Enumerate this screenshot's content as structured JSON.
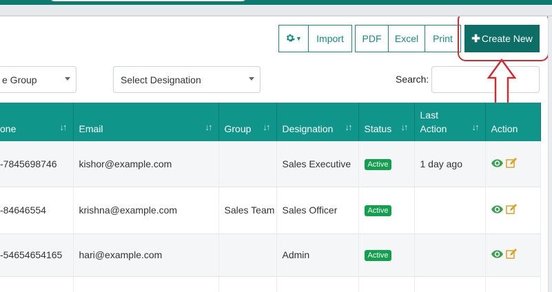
{
  "toolbar": {
    "import_label": "Import",
    "pdf_label": "PDF",
    "excel_label": "Excel",
    "print_label": "Print",
    "create_label": "Create New",
    "gear_icon": "gear-icon",
    "plus_icon": "plus-icon"
  },
  "filters": {
    "group_select": "e Group",
    "designation_select": "Select Designation",
    "search_label": "Search:",
    "search_value": ""
  },
  "table": {
    "columns": [
      "one",
      "Email",
      "Group",
      "Designation",
      "Status",
      "Last Action",
      "Action"
    ],
    "rows": [
      {
        "phone": "-7845698746",
        "email": "kishor@example.com",
        "group": "",
        "designation": "Sales Executive",
        "status": "Active",
        "last_action": "1 day ago"
      },
      {
        "phone": "-84646554",
        "email": "krishna@example.com",
        "group": "Sales Team",
        "designation": "Sales Officer",
        "status": "Active",
        "last_action": ""
      },
      {
        "phone": "-54654654165",
        "email": "hari@example.com",
        "group": "",
        "designation": "Admin",
        "status": "Active",
        "last_action": ""
      },
      {
        "phone": "",
        "email": "",
        "group": "",
        "designation": "",
        "status": "",
        "last_action": ""
      }
    ]
  },
  "colors": {
    "accent": "#0f958a",
    "header_bar": "#0d7a6f",
    "create_button": "#0c6e64",
    "status_active": "#11a14c",
    "annotation_red": "#d42a2f",
    "view_icon": "#3aa14f",
    "edit_icon": "#e0a020"
  }
}
